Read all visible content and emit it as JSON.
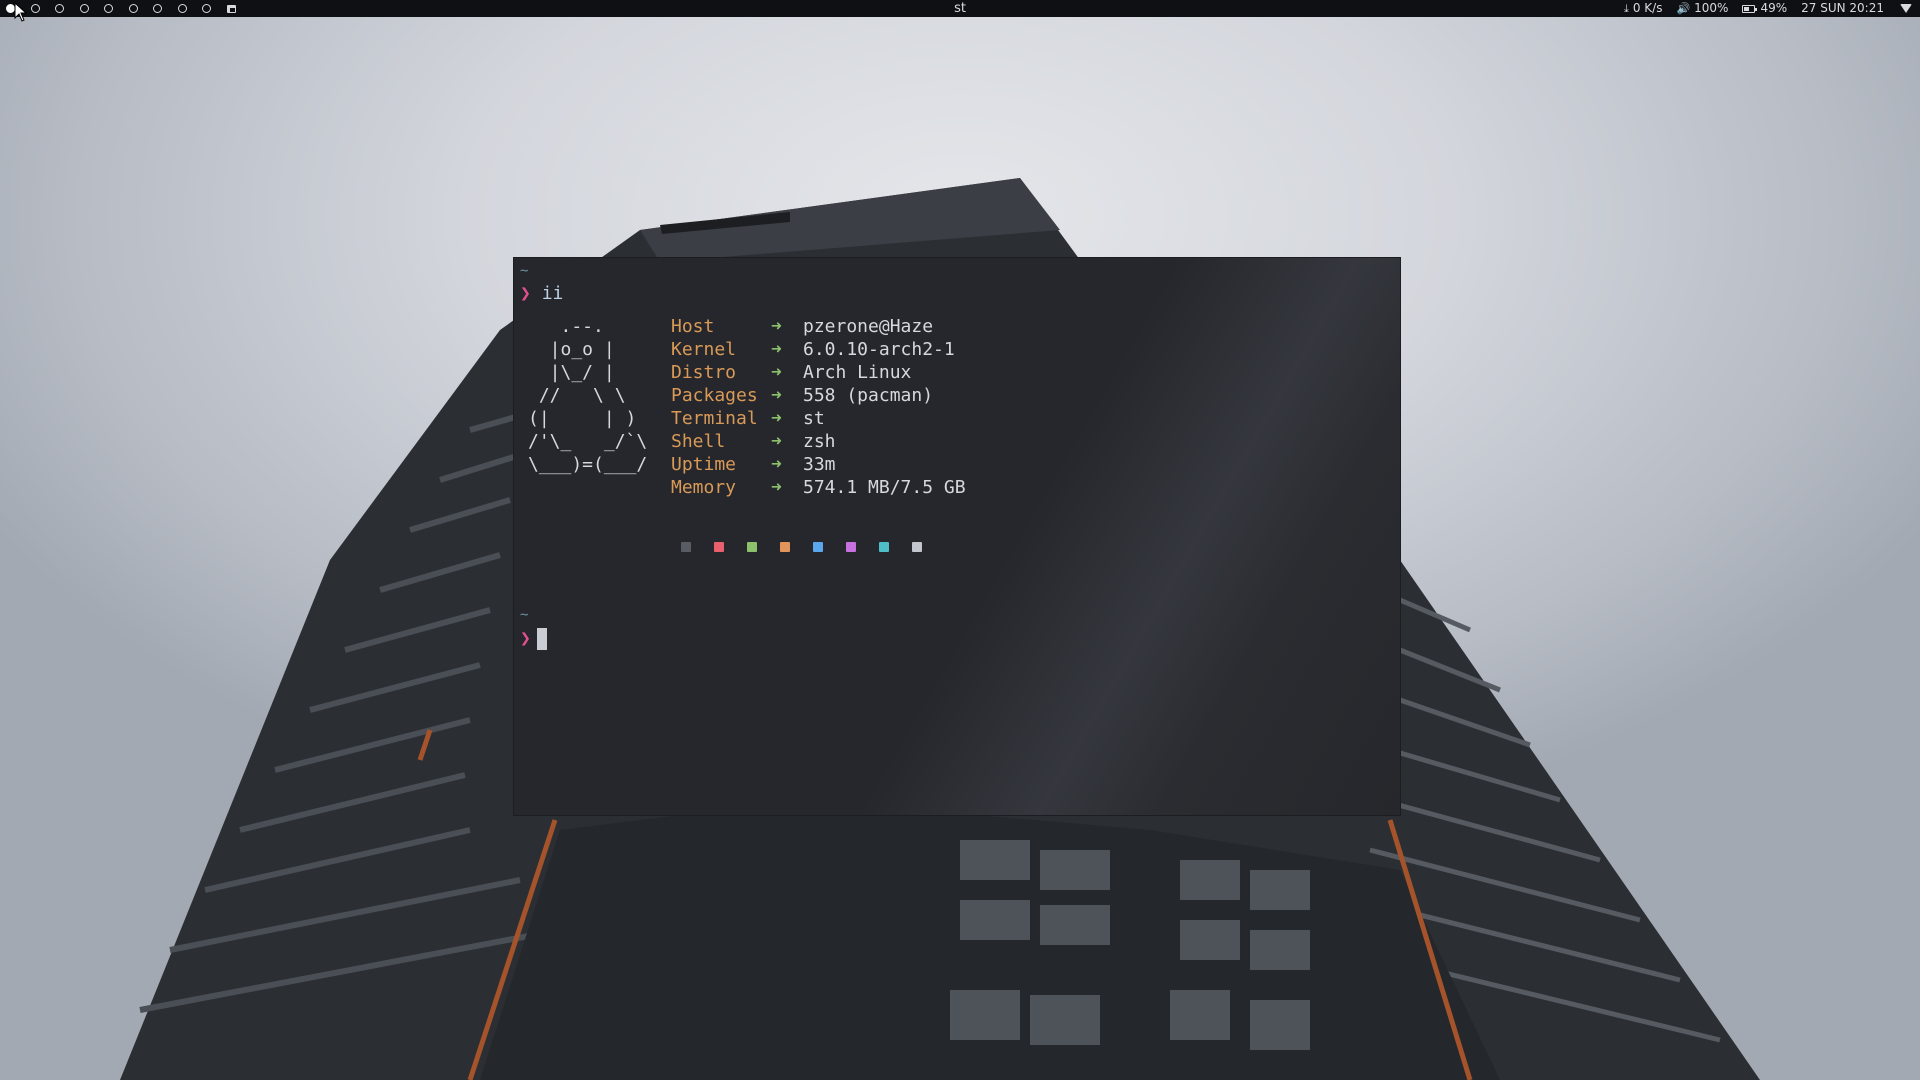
{
  "topbar": {
    "window_title": "st",
    "workspaces": [
      {
        "active": true
      },
      {
        "active": false
      },
      {
        "active": false
      },
      {
        "active": false
      },
      {
        "active": false
      },
      {
        "active": false
      },
      {
        "active": false
      },
      {
        "active": false
      },
      {
        "active": false
      }
    ],
    "layout_icon": "tile-layout-icon",
    "network": {
      "icon": "download-icon",
      "text": "0 K/s"
    },
    "volume": {
      "icon": "speaker-icon",
      "text": "100%"
    },
    "battery": {
      "icon": "battery-icon",
      "text": "49%",
      "level": 0.49
    },
    "datetime": "27 SUN 20:21",
    "wifi_icon": "wifi-icon"
  },
  "terminal": {
    "tilde": "~",
    "prompt_symbol": "❯",
    "command": "ii",
    "ascii_art": [
      "   .--.",
      "  |o_o |",
      "  |\\_/ |",
      " //   \\ \\",
      "(|     | )",
      "/'\\_   _/`\\",
      "\\___)=(___/"
    ],
    "info": [
      {
        "key": "Host",
        "arrow": "➜",
        "value": "pzerone@Haze"
      },
      {
        "key": "Kernel",
        "arrow": "➜",
        "value": "6.0.10-arch2-1"
      },
      {
        "key": "Distro",
        "arrow": "➜",
        "value": "Arch Linux"
      },
      {
        "key": "Packages",
        "arrow": "➜",
        "value": "558 (pacman)"
      },
      {
        "key": "Terminal",
        "arrow": "➜",
        "value": "st"
      },
      {
        "key": "Shell",
        "arrow": "➜",
        "value": "zsh"
      },
      {
        "key": "Uptime",
        "arrow": "➜",
        "value": "33m"
      },
      {
        "key": "Memory",
        "arrow": "➜",
        "value": "574.1 MB/7.5 GB"
      }
    ],
    "palette": [
      "#5a5c63",
      "#e8606d",
      "#8dc06c",
      "#e2955a",
      "#5aa7ee",
      "#c770e0",
      "#4fbfc7",
      "#c3c6cc"
    ]
  },
  "colors": {
    "bar_bg": "#0f1013",
    "terminal_bg": "#25272c",
    "prompt": "#e3508f",
    "info_key": "#d99a57",
    "info_arrow": "#8dc06c"
  }
}
